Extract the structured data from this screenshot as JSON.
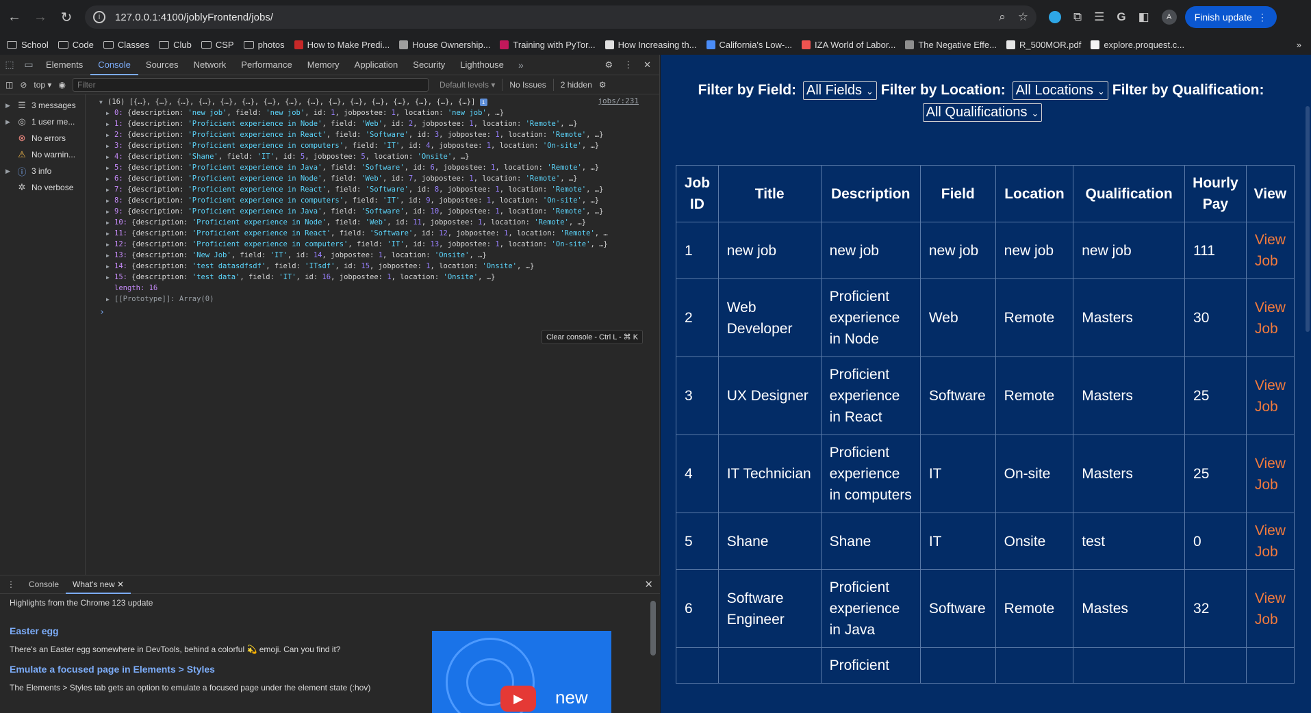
{
  "browser": {
    "url": "127.0.0.1:4100/joblyFrontend/jobs/",
    "finish_update": "Finish update",
    "avatar": "A",
    "bookmarks": [
      {
        "label": "School",
        "kind": "folder"
      },
      {
        "label": "Code",
        "kind": "folder"
      },
      {
        "label": "Classes",
        "kind": "folder"
      },
      {
        "label": "Club",
        "kind": "folder"
      },
      {
        "label": "CSP",
        "kind": "folder"
      },
      {
        "label": "photos",
        "kind": "folder"
      },
      {
        "label": "How to Make Predi...",
        "kind": "link"
      },
      {
        "label": "House Ownership...",
        "kind": "link"
      },
      {
        "label": "Training with PyTor...",
        "kind": "link"
      },
      {
        "label": "How Increasing th...",
        "kind": "link"
      },
      {
        "label": "California's Low-...",
        "kind": "link"
      },
      {
        "label": "IZA World of Labor...",
        "kind": "link"
      },
      {
        "label": "The Negative Effe...",
        "kind": "link"
      },
      {
        "label": "R_500MOR.pdf",
        "kind": "link"
      },
      {
        "label": "explore.proquest.c...",
        "kind": "link"
      }
    ]
  },
  "devtools": {
    "tabs": [
      "Elements",
      "Console",
      "Sources",
      "Network",
      "Performance",
      "Memory",
      "Application",
      "Security",
      "Lighthouse"
    ],
    "active_tab": "Console",
    "context": "top",
    "filter_placeholder": "Filter",
    "levels": "Default levels",
    "issues": "No Issues",
    "hidden": "2 hidden",
    "sidebar": [
      {
        "label": "3 messages",
        "icon": "list-icon"
      },
      {
        "label": "1 user me...",
        "icon": "user-icon"
      },
      {
        "label": "No errors",
        "icon": "error-icon"
      },
      {
        "label": "No warnin...",
        "icon": "warning-icon"
      },
      {
        "label": "3 info",
        "icon": "info-icon"
      },
      {
        "label": "No verbose",
        "icon": "bug-icon"
      }
    ],
    "console": {
      "source": "jobs/:231",
      "header": "(16) [{…}, {…}, {…}, {…}, {…}, {…}, {…}, {…}, {…}, {…}, {…}, {…}, {…}, {…}, {…}, {…}]",
      "entries": [
        "0: {description: 'new job', field: 'new job', id: 1, jobpostee: 1, location: 'new job', …}",
        "1: {description: 'Proficient experience in Node', field: 'Web', id: 2, jobpostee: 1, location: 'Remote', …}",
        "2: {description: 'Proficient experience in React', field: 'Software', id: 3, jobpostee: 1, location: 'Remote', …}",
        "3: {description: 'Proficient experience in computers', field: 'IT', id: 4, jobpostee: 1, location: 'On-site', …}",
        "4: {description: 'Shane', field: 'IT', id: 5, jobpostee: 5, location: 'Onsite', …}",
        "5: {description: 'Proficient experience in Java', field: 'Software', id: 6, jobpostee: 1, location: 'Remote', …}",
        "6: {description: 'Proficient experience in Node', field: 'Web', id: 7, jobpostee: 1, location: 'Remote', …}",
        "7: {description: 'Proficient experience in React', field: 'Software', id: 8, jobpostee: 1, location: 'Remote', …}",
        "8: {description: 'Proficient experience in computers', field: 'IT', id: 9, jobpostee: 1, location: 'On-site', …}",
        "9: {description: 'Proficient experience in Java', field: 'Software', id: 10, jobpostee: 1, location: 'Remote', …}",
        "10: {description: 'Proficient experience in Node', field: 'Web', id: 11, jobpostee: 1, location: 'Remote', …}",
        "11: {description: 'Proficient experience in React', field: 'Software', id: 12, jobpostee: 1, location: 'Remote', …",
        "12: {description: 'Proficient experience in computers', field: 'IT', id: 13, jobpostee: 1, location: 'On-site', …}",
        "13: {description: 'New Job', field: 'IT', id: 14, jobpostee: 1, location: 'Onsite', …}",
        "14: {description: 'test datasdfsdf', field: 'ITsdf', id: 15, jobpostee: 1, location: 'Onsite', …}",
        "15: {description: 'test data', field: 'IT', id: 16, jobpostee: 1, location: 'Onsite', …}"
      ],
      "length_line": "length: 16",
      "prototype_line": "[[Prototype]]: Array(0)",
      "tooltip": "Clear console - Ctrl L - ⌘ K"
    },
    "drawer": {
      "tabs": [
        "Console",
        "What's new"
      ],
      "active": "What's new",
      "headline": "Highlights from the Chrome 123 update",
      "item1_title": "Easter egg",
      "item1_text": "There's an Easter egg somewhere in DevTools, behind a colorful 💫 emoji. Can you find it?",
      "item2_title": "Emulate a focused page in Elements > Styles",
      "item2_text": "The Elements > Styles tab gets an option to emulate a focused page under the element state (:hov)",
      "promo_word": "new"
    }
  },
  "page": {
    "filters": {
      "field_label": "Filter by Field:",
      "field_value": "All Fields",
      "location_label": "Filter by Location:",
      "location_value": "All Locations",
      "qualification_label": "Filter by Qualification:",
      "qualification_value": "All Qualifications"
    },
    "table": {
      "headers": [
        "Job ID",
        "Title",
        "Description",
        "Field",
        "Location",
        "Qualification",
        "Hourly Pay",
        "View"
      ],
      "rows": [
        {
          "id": "1",
          "title": "new job",
          "description": "new job",
          "field": "new job",
          "location": "new job",
          "qualification": "new job",
          "pay": "111",
          "view": "View Job"
        },
        {
          "id": "2",
          "title": "Web Developer",
          "description": "Proficient experience in Node",
          "field": "Web",
          "location": "Remote",
          "qualification": "Masters",
          "pay": "30",
          "view": "View Job"
        },
        {
          "id": "3",
          "title": "UX Designer",
          "description": "Proficient experience in React",
          "field": "Software",
          "location": "Remote",
          "qualification": "Masters",
          "pay": "25",
          "view": "View Job"
        },
        {
          "id": "4",
          "title": "IT Technician",
          "description": "Proficient experience in computers",
          "field": "IT",
          "location": "On-site",
          "qualification": "Masters",
          "pay": "25",
          "view": "View Job"
        },
        {
          "id": "5",
          "title": "Shane",
          "description": "Shane",
          "field": "IT",
          "location": "Onsite",
          "qualification": "test",
          "pay": "0",
          "view": "View Job"
        },
        {
          "id": "6",
          "title": "Software Engineer",
          "description": "Proficient experience in Java",
          "field": "Software",
          "location": "Remote",
          "qualification": "Mastes",
          "pay": "32",
          "view": "View Job"
        },
        {
          "id": "",
          "title": "",
          "description": "Proficient",
          "field": "",
          "location": "",
          "qualification": "",
          "pay": "",
          "view": ""
        }
      ]
    },
    "colors": {
      "background": "#032c66",
      "link": "#f47b3c",
      "accent": "#7cacf8"
    }
  }
}
